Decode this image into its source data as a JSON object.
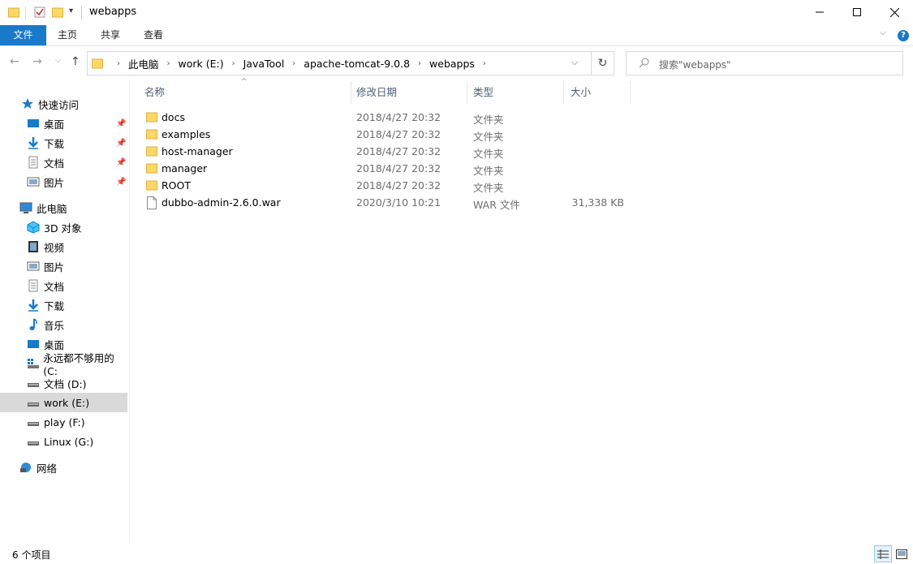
{
  "window": {
    "title": "webapps"
  },
  "ribbon": {
    "tabs": [
      "文件",
      "主页",
      "共享",
      "查看"
    ]
  },
  "address": {
    "crumbs": [
      "此电脑",
      "work (E:)",
      "JavaTool",
      "apache-tomcat-9.0.8",
      "webapps"
    ]
  },
  "search": {
    "placeholder": "搜索\"webapps\""
  },
  "nav": {
    "quick_access": "快速访问",
    "quick_items": [
      "桌面",
      "下载",
      "文档",
      "图片"
    ],
    "this_pc": "此电脑",
    "pc_items": [
      "3D 对象",
      "视频",
      "图片",
      "文档",
      "下载",
      "音乐",
      "桌面",
      "永远都不够用的 (C:",
      "文档 (D:)",
      "work (E:)",
      "play (F:)",
      "Linux (G:)"
    ],
    "network": "网络"
  },
  "columns": {
    "name": "名称",
    "date": "修改日期",
    "type": "类型",
    "size": "大小"
  },
  "files": [
    {
      "name": "docs",
      "date": "2018/4/27 20:32",
      "type": "文件夹",
      "size": "",
      "icon": "folder-icon"
    },
    {
      "name": "examples",
      "date": "2018/4/27 20:32",
      "type": "文件夹",
      "size": "",
      "icon": "folder-icon"
    },
    {
      "name": "host-manager",
      "date": "2018/4/27 20:32",
      "type": "文件夹",
      "size": "",
      "icon": "folder-icon"
    },
    {
      "name": "manager",
      "date": "2018/4/27 20:32",
      "type": "文件夹",
      "size": "",
      "icon": "folder-icon"
    },
    {
      "name": "ROOT",
      "date": "2018/4/27 20:32",
      "type": "文件夹",
      "size": "",
      "icon": "folder-icon"
    },
    {
      "name": "dubbo-admin-2.6.0.war",
      "date": "2020/3/10 10:21",
      "type": "WAR 文件",
      "size": "31,338 KB",
      "icon": "file-icon"
    }
  ],
  "status": {
    "count": "6 个项目"
  },
  "colors": {
    "accent": "#1979ca",
    "folder": "#ffd766",
    "selected": "#d9d9d9"
  }
}
